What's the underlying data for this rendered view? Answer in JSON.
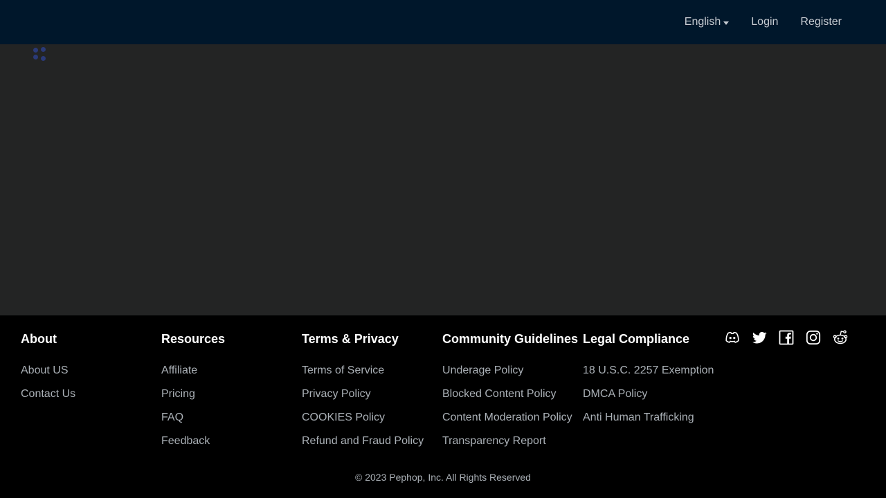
{
  "header": {
    "language": "English",
    "login": "Login",
    "register": "Register"
  },
  "footer": {
    "columns": [
      {
        "title": "About",
        "links": [
          "About US",
          "Contact Us"
        ]
      },
      {
        "title": "Resources",
        "links": [
          "Affiliate",
          "Pricing",
          "FAQ",
          "Feedback"
        ]
      },
      {
        "title": "Terms & Privacy",
        "links": [
          "Terms of Service",
          "Privacy Policy",
          "COOKIES Policy",
          "Refund and Fraud Policy"
        ]
      },
      {
        "title": "Community Guidelines",
        "links": [
          "Underage Policy",
          "Blocked Content Policy",
          "Content Moderation Policy",
          "Transparency Report"
        ]
      },
      {
        "title": "Legal Compliance",
        "links": [
          "18 U.S.C. 2257 Exemption",
          "DMCA Policy",
          "Anti Human Trafficking"
        ]
      }
    ],
    "social_icons": [
      "discord-icon",
      "twitter-icon",
      "facebook-icon",
      "instagram-icon",
      "reddit-icon"
    ],
    "copyright": "© 2023 Pephop, Inc. All Rights Reserved"
  },
  "colors": {
    "header_bg": "#00172b",
    "main_bg": "#232424",
    "footer_bg": "#000000",
    "spinner": "#2a3a78"
  }
}
